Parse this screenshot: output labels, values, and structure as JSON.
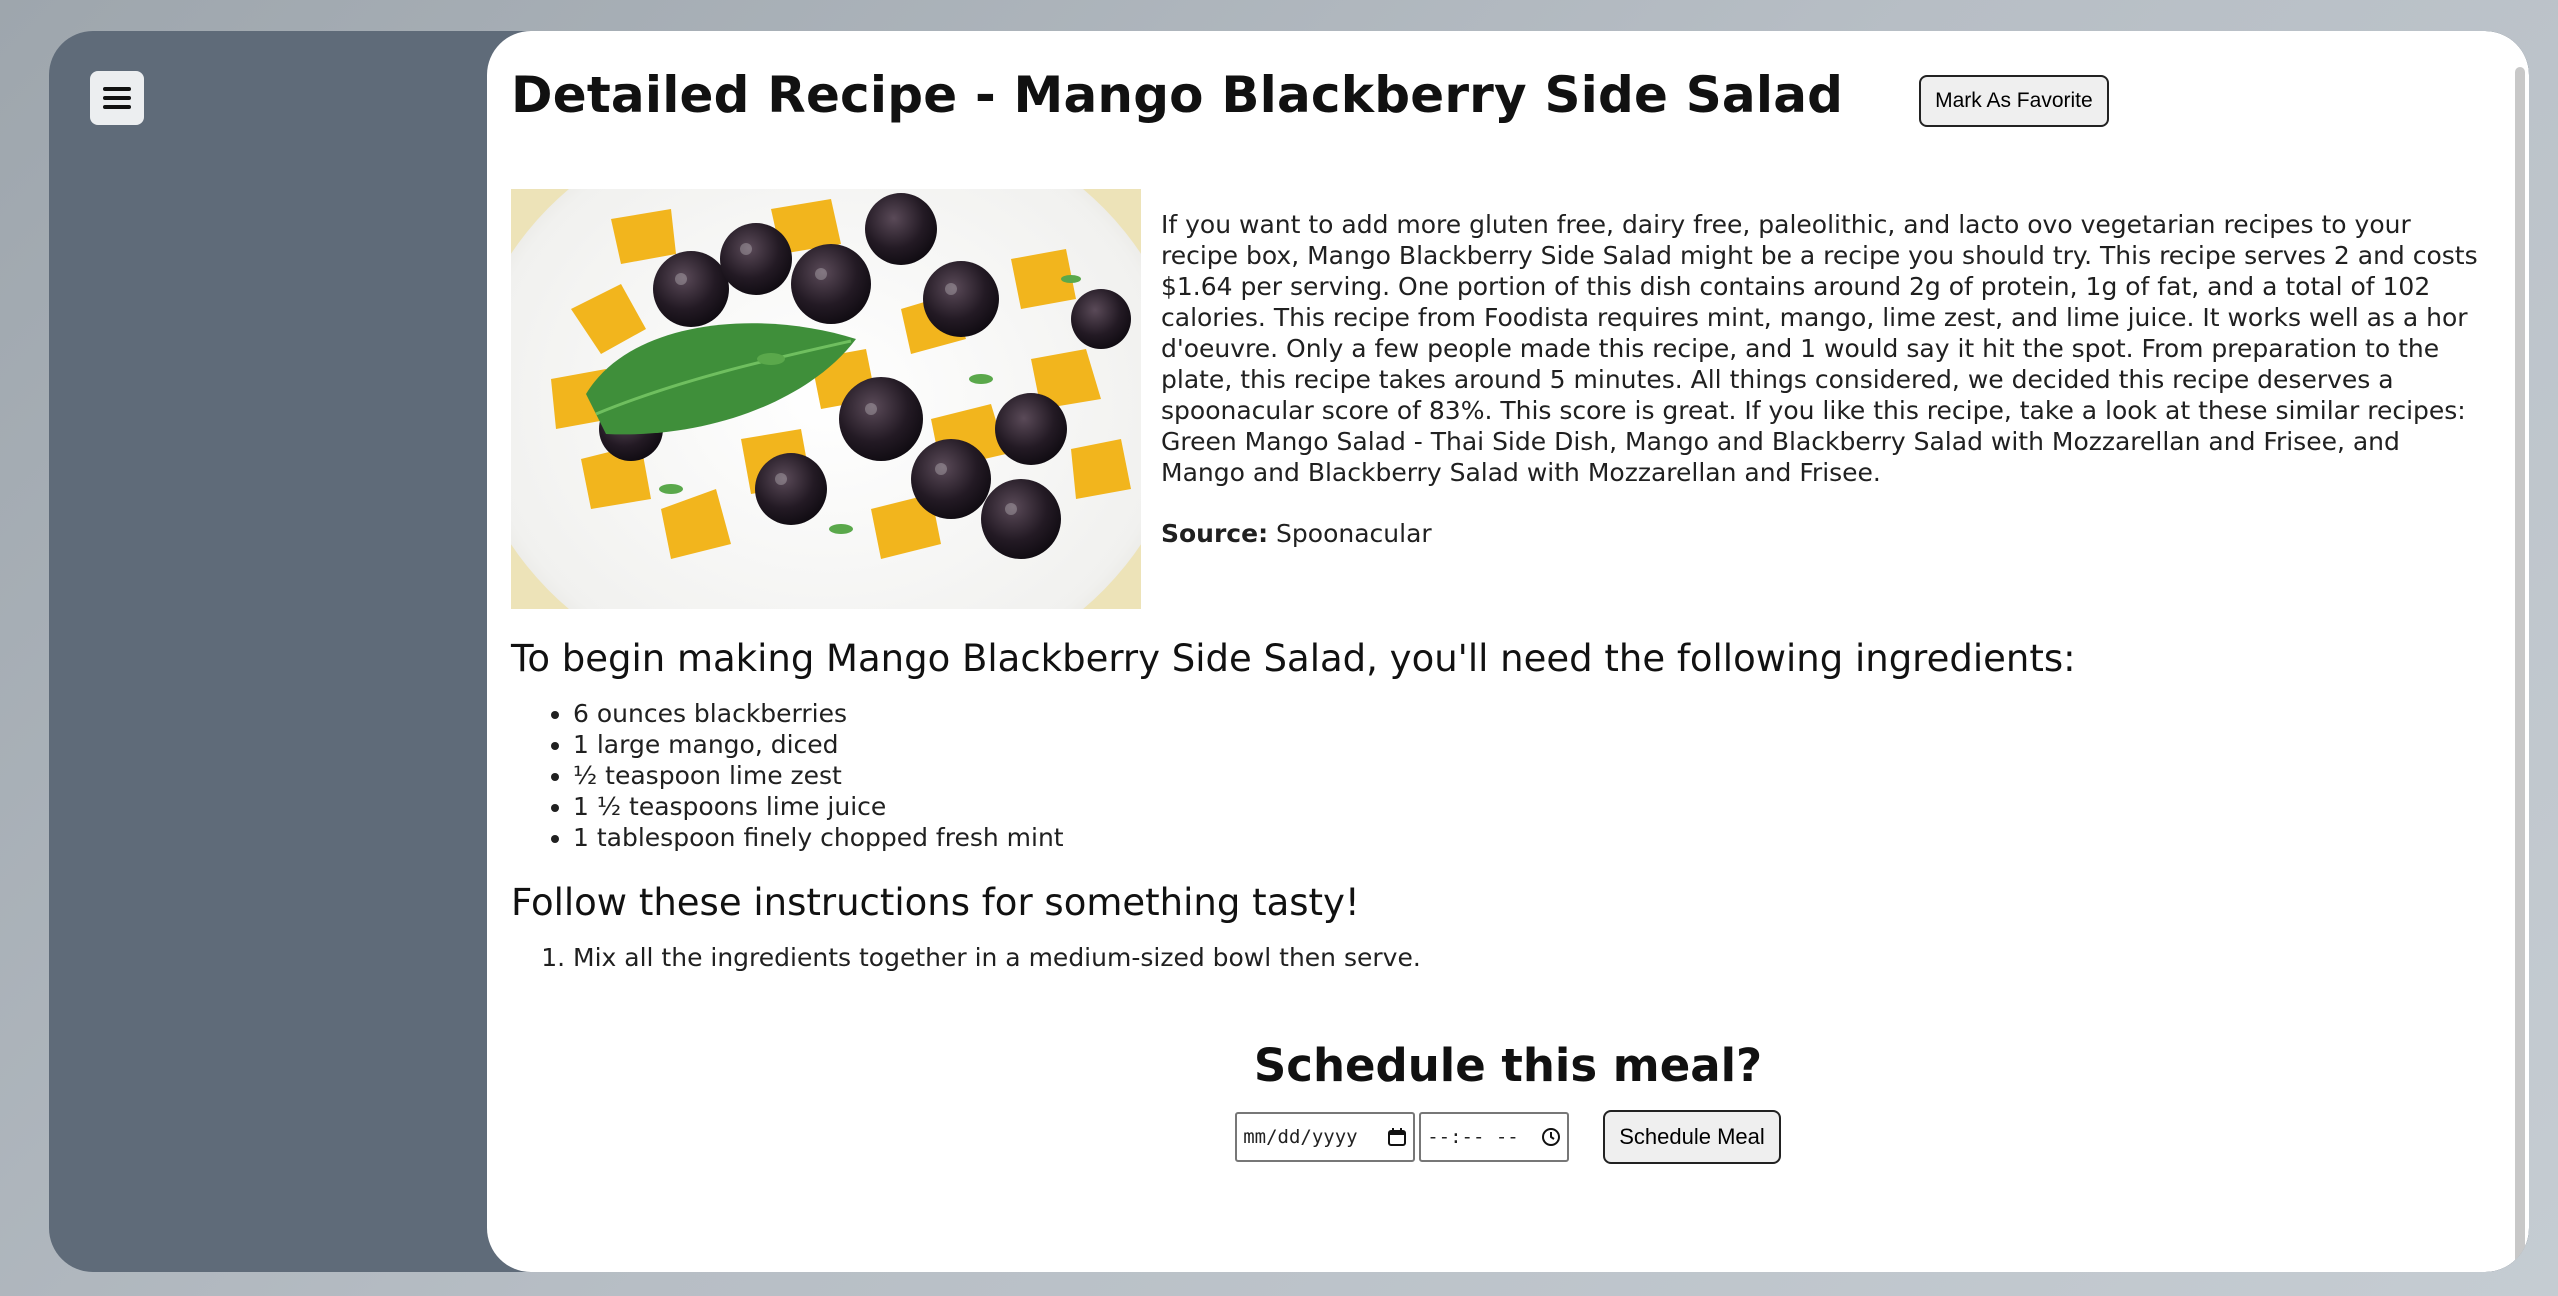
{
  "page": {
    "title": "Detailed Recipe - Mango Blackberry Side Salad",
    "favorite_label": "Mark As Favorite"
  },
  "sidebar": {
    "menu_icon": "hamburger-menu-icon"
  },
  "recipe": {
    "image_alt": "Mango Blackberry Side Salad",
    "summary": "If you want to add more gluten free, dairy free, paleolithic, and lacto ovo vegetarian recipes to your recipe box, Mango Blackberry Side Salad might be a recipe you should try. This recipe serves 2 and costs $1.64 per serving. One portion of this dish contains around 2g of protein, 1g of fat, and a total of 102 calories. This recipe from Foodista requires mint, mango, lime zest, and lime juice. It works well as a hor d'oeuvre. Only a few people made this recipe, and 1 would say it hit the spot. From preparation to the plate, this recipe takes around 5 minutes. All things considered, we decided this recipe deserves a spoonacular score of 83%. This score is great. If you like this recipe, take a look at these similar recipes: Green Mango Salad - Thai Side Dish, Mango and Blackberry Salad with Mozzarellan and Frisee, and Mango and Blackberry Salad with Mozzarellan and Frisee.",
    "source_label": "Source:",
    "source_value": "Spoonacular",
    "ingredients_heading": "To begin making Mango Blackberry Side Salad, you'll need the following ingredients:",
    "ingredients": [
      "6 ounces blackberries",
      "1 large mango, diced",
      "½ teaspoon lime zest",
      "1 ½ teaspoons lime juice",
      "1 tablespoon finely chopped fresh mint"
    ],
    "instructions_heading": "Follow these instructions for something tasty!",
    "instructions": [
      "Mix all the ingredients together in a medium-sized bowl then serve."
    ]
  },
  "schedule": {
    "heading": "Schedule this meal?",
    "date_placeholder": "mm/dd/yyyy",
    "time_placeholder": "--:-- --",
    "button_label": "Schedule Meal"
  },
  "colors": {
    "sidebar_bg": "#5f6b79",
    "main_bg": "#ffffff",
    "button_bg": "#efefef"
  }
}
